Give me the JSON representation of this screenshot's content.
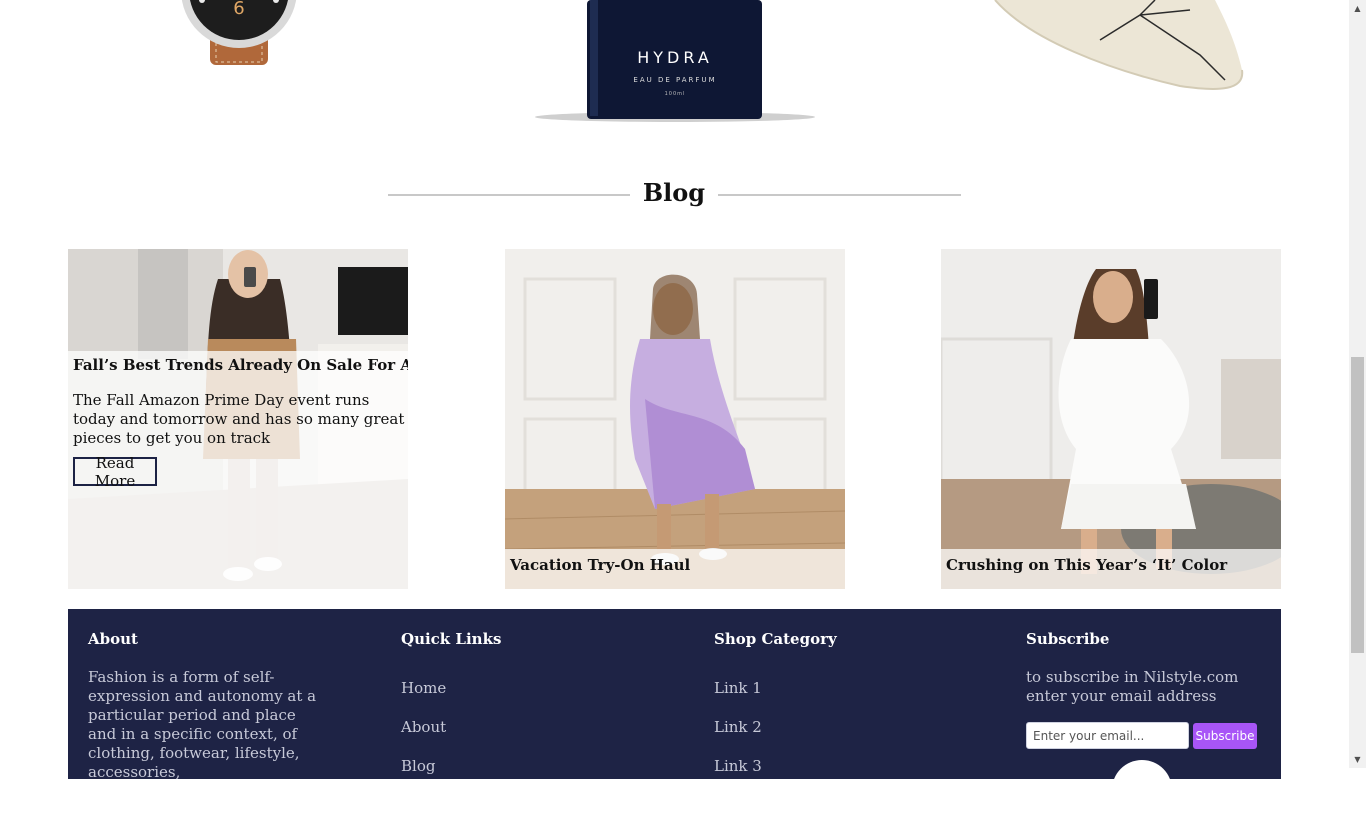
{
  "products": {
    "perfume_brand": "HYDRA",
    "perfume_type": "EAU DE PARFUM",
    "perfume_volume": "100ml",
    "watch_numeral": "6"
  },
  "blog": {
    "heading": "Blog",
    "posts": [
      {
        "title": "Fall’s Best Trends Already On Sale For Amazon",
        "excerpt": "The Fall Amazon Prime Day event runs today and tomorrow and has so many great pieces to get you on track",
        "read_more": "Read More"
      },
      {
        "title": "Vacation Try-On Haul"
      },
      {
        "title": "Crushing on This Year’s ‘It’ Color"
      }
    ]
  },
  "footer": {
    "about": {
      "heading": "About",
      "text": "Fashion is a form of self-expression and autonomy at a particular period and place and in a specific context, of clothing, footwear, lifestyle, accessories,"
    },
    "quick_links": {
      "heading": "Quick Links",
      "items": [
        "Home",
        "About",
        "Blog"
      ]
    },
    "shop_category": {
      "heading": "Shop Category",
      "items": [
        "Link 1",
        "Link 2",
        "Link 3"
      ]
    },
    "subscribe": {
      "heading": "Subscribe",
      "text": "to subscribe in Nilstyle.com enter your email address",
      "placeholder": "Enter your email...",
      "button": "Subscribe",
      "button_color": "#a855f7"
    },
    "background_color": "#1e2345"
  }
}
